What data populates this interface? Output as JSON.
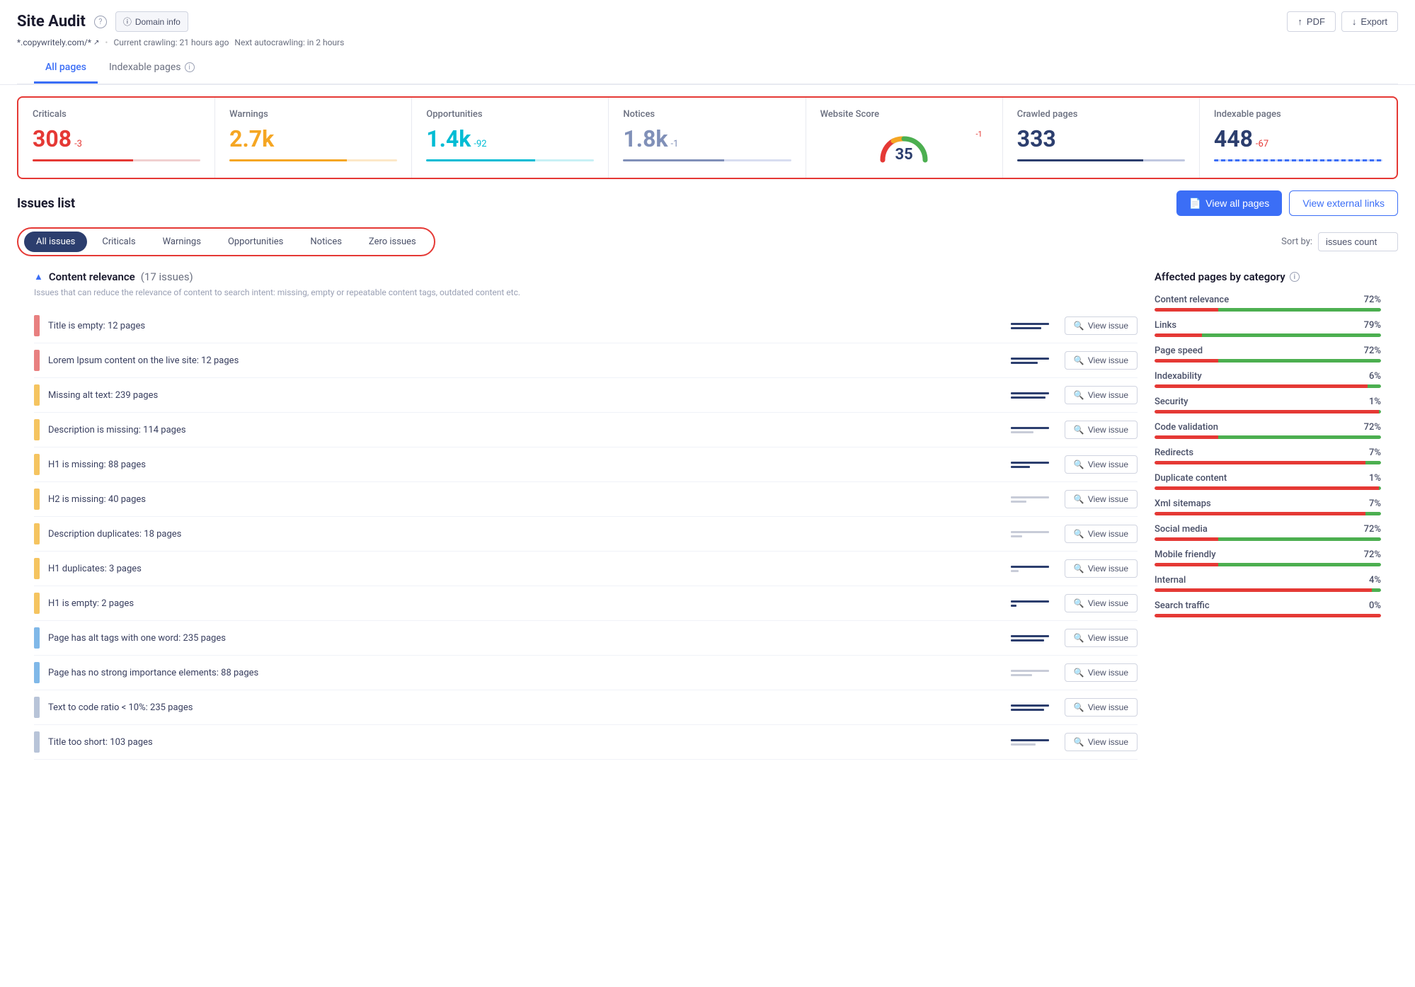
{
  "header": {
    "title": "Site Audit",
    "domain_info_label": "Domain info",
    "pdf_label": "PDF",
    "export_label": "Export",
    "domain": "*.copywritely.com/*",
    "crawling_info": "Current crawling: 21 hours ago",
    "next_crawling": "Next autocrawling: in 2 hours"
  },
  "tabs": [
    {
      "label": "All pages",
      "active": true
    },
    {
      "label": "Indexable pages",
      "active": false
    }
  ],
  "stats": [
    {
      "label": "Criticals",
      "value": "308",
      "delta": "-3",
      "bar_type": "red",
      "value_color": "red"
    },
    {
      "label": "Warnings",
      "value": "2.7k",
      "delta": "",
      "bar_type": "orange",
      "value_color": "orange"
    },
    {
      "label": "Opportunities",
      "value": "1.4k",
      "delta": "-92",
      "bar_type": "teal",
      "value_color": "teal"
    },
    {
      "label": "Notices",
      "value": "1.8k",
      "delta": "-1",
      "bar_type": "blue-gray",
      "value_color": "gray-blue"
    },
    {
      "label": "Website Score",
      "value": "35",
      "delta": "-1",
      "bar_type": "gauge",
      "value_color": "dark"
    },
    {
      "label": "Crawled pages",
      "value": "333",
      "delta": "",
      "bar_type": "dark-blue",
      "value_color": "dark"
    },
    {
      "label": "Indexable pages",
      "value": "448",
      "delta": "-67",
      "bar_type": "wavy",
      "value_color": "dark"
    }
  ],
  "issues_section": {
    "title": "Issues list",
    "view_all_label": "View all pages",
    "view_external_label": "View external links"
  },
  "filter_tabs": [
    {
      "label": "All issues",
      "active": true
    },
    {
      "label": "Criticals",
      "active": false
    },
    {
      "label": "Warnings",
      "active": false
    },
    {
      "label": "Opportunities",
      "active": false
    },
    {
      "label": "Notices",
      "active": false
    },
    {
      "label": "Zero issues",
      "active": false
    }
  ],
  "sort": {
    "label": "Sort by:",
    "value": "issues count"
  },
  "content_section": {
    "toggle": "▲",
    "title": "Content relevance",
    "count": "(17 issues)",
    "description": "Issues that can reduce the relevance of content to search intent: missing, empty or repeatable content tags, outdated content etc."
  },
  "issues": [
    {
      "type": "critical",
      "text": "Title is empty:",
      "pages": "12 pages"
    },
    {
      "type": "critical",
      "text": "Lorem Ipsum content on the live site:",
      "pages": "12 pages"
    },
    {
      "type": "warning",
      "text": "Missing alt text:",
      "pages": "239 pages"
    },
    {
      "type": "warning",
      "text": "Description is missing:",
      "pages": "114 pages"
    },
    {
      "type": "warning",
      "text": "H1 is missing:",
      "pages": "88 pages"
    },
    {
      "type": "warning",
      "text": "H2 is missing:",
      "pages": "40 pages"
    },
    {
      "type": "warning",
      "text": "Description duplicates:",
      "pages": "18 pages"
    },
    {
      "type": "warning",
      "text": "H1 duplicates:",
      "pages": "3 pages"
    },
    {
      "type": "warning",
      "text": "H1 is empty:",
      "pages": "2 pages"
    },
    {
      "type": "info",
      "text": "Page has alt tags with one word:",
      "pages": "235 pages"
    },
    {
      "type": "info",
      "text": "Page has no strong importance elements:",
      "pages": "88 pages"
    },
    {
      "type": "notice",
      "text": "Text to code ratio < 10%:",
      "pages": "235 pages"
    },
    {
      "type": "notice",
      "text": "Title too short:",
      "pages": "103 pages"
    }
  ],
  "view_issue_label": "View issue",
  "sidebar": {
    "title": "Affected pages by category",
    "categories": [
      {
        "name": "Content relevance",
        "pct": 72,
        "pct_label": "72%"
      },
      {
        "name": "Links",
        "pct": 79,
        "pct_label": "79%"
      },
      {
        "name": "Page speed",
        "pct": 72,
        "pct_label": "72%"
      },
      {
        "name": "Indexability",
        "pct": 6,
        "pct_label": "6%"
      },
      {
        "name": "Security",
        "pct": 1,
        "pct_label": "1%"
      },
      {
        "name": "Code validation",
        "pct": 72,
        "pct_label": "72%"
      },
      {
        "name": "Redirects",
        "pct": 7,
        "pct_label": "7%"
      },
      {
        "name": "Duplicate content",
        "pct": 1,
        "pct_label": "1%"
      },
      {
        "name": "Xml sitemaps",
        "pct": 7,
        "pct_label": "7%"
      },
      {
        "name": "Social media",
        "pct": 72,
        "pct_label": "72%"
      },
      {
        "name": "Mobile friendly",
        "pct": 72,
        "pct_label": "72%"
      },
      {
        "name": "Internal",
        "pct": 4,
        "pct_label": "4%"
      },
      {
        "name": "Search traffic",
        "pct": 0,
        "pct_label": "0%"
      }
    ]
  }
}
